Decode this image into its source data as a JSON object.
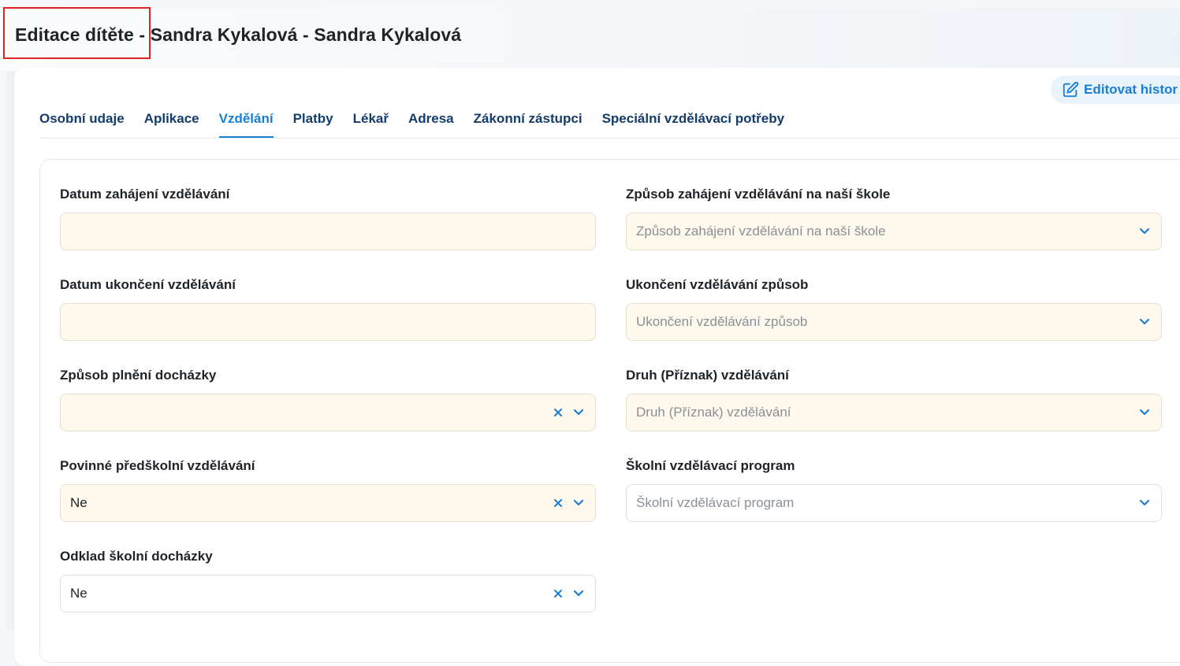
{
  "header": {
    "title": "Editace dítěte - Sandra Kykalová - Sandra Kykalová"
  },
  "actions": {
    "edit_history_label": "Editovat histor"
  },
  "tabs": [
    {
      "label": "Osobní udaje",
      "active": false
    },
    {
      "label": "Aplikace",
      "active": false
    },
    {
      "label": "Vzdělání",
      "active": true
    },
    {
      "label": "Platby",
      "active": false
    },
    {
      "label": "Lékař",
      "active": false
    },
    {
      "label": "Adresa",
      "active": false
    },
    {
      "label": "Zákonní zástupci",
      "active": false
    },
    {
      "label": "Speciální vzdělávací potřeby",
      "active": false
    }
  ],
  "form": {
    "start_date": {
      "label": "Datum zahájení vzdělávání",
      "value": ""
    },
    "end_date": {
      "label": "Datum ukončení vzdělávání",
      "value": ""
    },
    "attendance_mode": {
      "label": "Způsob plnění docházky",
      "value": ""
    },
    "mandatory_preschool": {
      "label": "Povinné předškolní vzdělávání",
      "value": "Ne"
    },
    "school_deferral": {
      "label": "Odklad školní docházky",
      "value": "Ne"
    },
    "start_method": {
      "label": "Způsob zahájení vzdělávání na naší škole",
      "placeholder": "Způsob zahájení vzdělávání na naší škole"
    },
    "end_method": {
      "label": "Ukončení vzdělávání způsob",
      "placeholder": "Ukončení vzdělávání způsob"
    },
    "education_type": {
      "label": "Druh (Příznak) vzdělávání",
      "placeholder": "Druh (Příznak) vzdělávání"
    },
    "school_program": {
      "label": "Školní vzdělávací program",
      "placeholder": "Školní vzdělávací program"
    }
  },
  "colors": {
    "accent": "#1a7fd4",
    "tab_text": "#143c6b",
    "required_field_bg": "#fff8ec",
    "highlight_border": "#e02424"
  }
}
